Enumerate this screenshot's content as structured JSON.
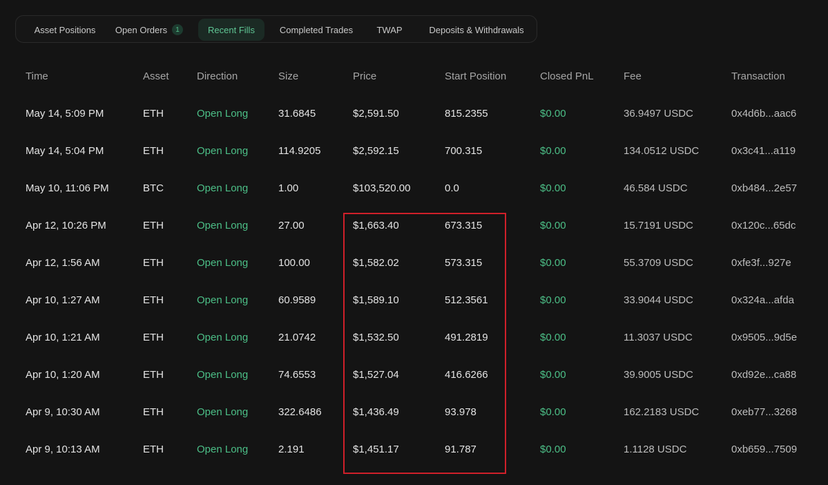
{
  "tabs": [
    {
      "label": "Asset Positions",
      "active": false
    },
    {
      "label": "Open Orders",
      "active": false,
      "badge": "1"
    },
    {
      "label": "Recent Fills",
      "active": true
    },
    {
      "label": "Completed Trades",
      "active": false
    },
    {
      "label": "TWAP",
      "active": false
    },
    {
      "label": "Deposits & Withdrawals",
      "active": false
    }
  ],
  "table": {
    "columns": [
      "Time",
      "Asset",
      "Direction",
      "Size",
      "Price",
      "Start Position",
      "Closed PnL",
      "Fee",
      "Transaction"
    ],
    "rows": [
      {
        "time": "May 14, 5:09 PM",
        "asset": "ETH",
        "direction": "Open Long",
        "size": "31.6845",
        "price": "$2,591.50",
        "start": "815.2355",
        "pnl": "$0.00",
        "fee": "36.9497 USDC",
        "tx": "0x4d6b...aac6"
      },
      {
        "time": "May 14, 5:04 PM",
        "asset": "ETH",
        "direction": "Open Long",
        "size": "114.9205",
        "price": "$2,592.15",
        "start": "700.315",
        "pnl": "$0.00",
        "fee": "134.0512 USDC",
        "tx": "0x3c41...a119"
      },
      {
        "time": "May 10, 11:06 PM",
        "asset": "BTC",
        "direction": "Open Long",
        "size": "1.00",
        "price": "$103,520.00",
        "start": "0.0",
        "pnl": "$0.00",
        "fee": "46.584 USDC",
        "tx": "0xb484...2e57"
      },
      {
        "time": "Apr 12, 10:26 PM",
        "asset": "ETH",
        "direction": "Open Long",
        "size": "27.00",
        "price": "$1,663.40",
        "start": "673.315",
        "pnl": "$0.00",
        "fee": "15.7191 USDC",
        "tx": "0x120c...65dc"
      },
      {
        "time": "Apr 12, 1:56 AM",
        "asset": "ETH",
        "direction": "Open Long",
        "size": "100.00",
        "price": "$1,582.02",
        "start": "573.315",
        "pnl": "$0.00",
        "fee": "55.3709 USDC",
        "tx": "0xfe3f...927e"
      },
      {
        "time": "Apr 10, 1:27 AM",
        "asset": "ETH",
        "direction": "Open Long",
        "size": "60.9589",
        "price": "$1,589.10",
        "start": "512.3561",
        "pnl": "$0.00",
        "fee": "33.9044 USDC",
        "tx": "0x324a...afda"
      },
      {
        "time": "Apr 10, 1:21 AM",
        "asset": "ETH",
        "direction": "Open Long",
        "size": "21.0742",
        "price": "$1,532.50",
        "start": "491.2819",
        "pnl": "$0.00",
        "fee": "11.3037 USDC",
        "tx": "0x9505...9d5e"
      },
      {
        "time": "Apr 10, 1:20 AM",
        "asset": "ETH",
        "direction": "Open Long",
        "size": "74.6553",
        "price": "$1,527.04",
        "start": "416.6266",
        "pnl": "$0.00",
        "fee": "39.9005 USDC",
        "tx": "0xd92e...ca88"
      },
      {
        "time": "Apr 9, 10:30 AM",
        "asset": "ETH",
        "direction": "Open Long",
        "size": "322.6486",
        "price": "$1,436.49",
        "start": "93.978",
        "pnl": "$0.00",
        "fee": "162.2183 USDC",
        "tx": "0xeb77...3268"
      },
      {
        "time": "Apr 9, 10:13 AM",
        "asset": "ETH",
        "direction": "Open Long",
        "size": "2.191",
        "price": "$1,451.17",
        "start": "91.787",
        "pnl": "$0.00",
        "fee": "1.1128 USDC",
        "tx": "0xb659...7509"
      }
    ]
  },
  "colors": {
    "background": "#141414",
    "accent_green": "#4cbf87",
    "highlight_red": "#d0202a"
  }
}
